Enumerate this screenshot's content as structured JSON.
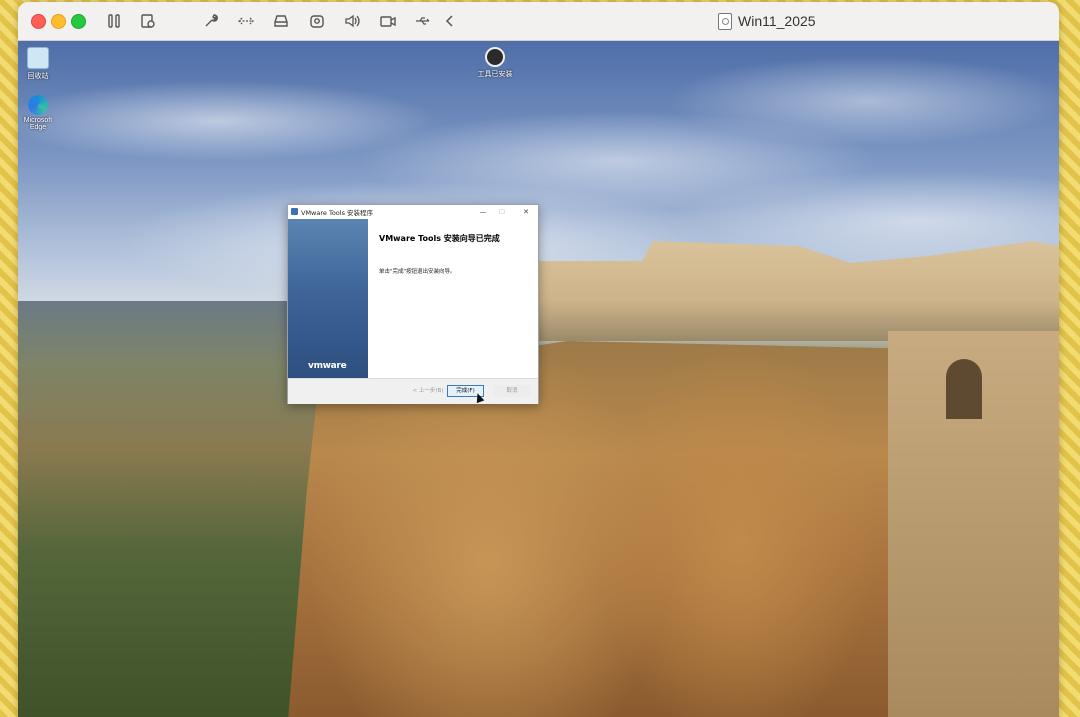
{
  "host": {
    "vm_name": "Win11_2025",
    "toolbar_icons": [
      "pause-icon",
      "snapshot-icon",
      "wrench-icon",
      "network-icon",
      "disk-icon",
      "camera-icon",
      "sound-icon",
      "video-icon",
      "usb-icon",
      "back-icon"
    ],
    "traffic_colors": {
      "close": "#fe5f57",
      "minimize": "#febc2e",
      "maximize": "#28c840"
    }
  },
  "desktop": {
    "icons": [
      {
        "name": "recycle-bin-icon",
        "label": "回收站"
      },
      {
        "name": "edge-icon",
        "label": "Microsoft Edge"
      },
      {
        "name": "user-folder-icon",
        "label": "工具已安装"
      }
    ]
  },
  "dialog": {
    "title": "VMware Tools 安装程序",
    "controls": {
      "minimize": "—",
      "maximize": "☐",
      "close": "✕"
    },
    "brand": "vmware",
    "heading": "VMware Tools 安装向导已完成",
    "body": "单击\"完成\"按钮退出安装向导。",
    "buttons": {
      "back": "< 上一步(B)",
      "finish": "完成(F)",
      "cancel": "取消"
    },
    "accent": "#3a78c2"
  }
}
